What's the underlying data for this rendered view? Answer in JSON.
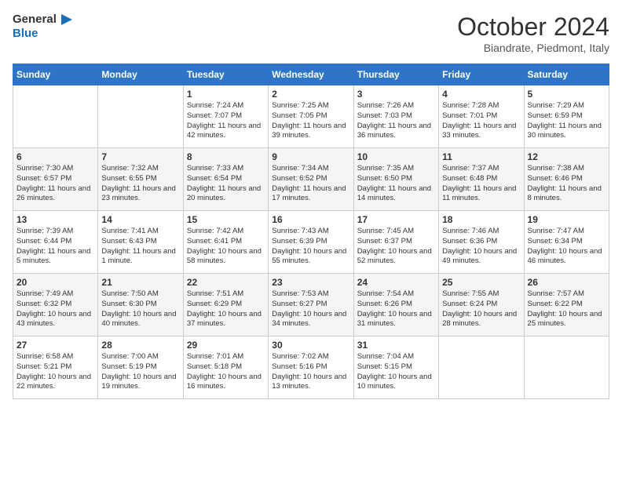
{
  "header": {
    "logo_line1": "General",
    "logo_line2": "Blue",
    "month": "October 2024",
    "location": "Biandrate, Piedmont, Italy"
  },
  "days_of_week": [
    "Sunday",
    "Monday",
    "Tuesday",
    "Wednesday",
    "Thursday",
    "Friday",
    "Saturday"
  ],
  "weeks": [
    [
      {
        "day": "",
        "info": ""
      },
      {
        "day": "",
        "info": ""
      },
      {
        "day": "1",
        "info": "Sunrise: 7:24 AM\nSunset: 7:07 PM\nDaylight: 11 hours and 42 minutes."
      },
      {
        "day": "2",
        "info": "Sunrise: 7:25 AM\nSunset: 7:05 PM\nDaylight: 11 hours and 39 minutes."
      },
      {
        "day": "3",
        "info": "Sunrise: 7:26 AM\nSunset: 7:03 PM\nDaylight: 11 hours and 36 minutes."
      },
      {
        "day": "4",
        "info": "Sunrise: 7:28 AM\nSunset: 7:01 PM\nDaylight: 11 hours and 33 minutes."
      },
      {
        "day": "5",
        "info": "Sunrise: 7:29 AM\nSunset: 6:59 PM\nDaylight: 11 hours and 30 minutes."
      }
    ],
    [
      {
        "day": "6",
        "info": "Sunrise: 7:30 AM\nSunset: 6:57 PM\nDaylight: 11 hours and 26 minutes."
      },
      {
        "day": "7",
        "info": "Sunrise: 7:32 AM\nSunset: 6:55 PM\nDaylight: 11 hours and 23 minutes."
      },
      {
        "day": "8",
        "info": "Sunrise: 7:33 AM\nSunset: 6:54 PM\nDaylight: 11 hours and 20 minutes."
      },
      {
        "day": "9",
        "info": "Sunrise: 7:34 AM\nSunset: 6:52 PM\nDaylight: 11 hours and 17 minutes."
      },
      {
        "day": "10",
        "info": "Sunrise: 7:35 AM\nSunset: 6:50 PM\nDaylight: 11 hours and 14 minutes."
      },
      {
        "day": "11",
        "info": "Sunrise: 7:37 AM\nSunset: 6:48 PM\nDaylight: 11 hours and 11 minutes."
      },
      {
        "day": "12",
        "info": "Sunrise: 7:38 AM\nSunset: 6:46 PM\nDaylight: 11 hours and 8 minutes."
      }
    ],
    [
      {
        "day": "13",
        "info": "Sunrise: 7:39 AM\nSunset: 6:44 PM\nDaylight: 11 hours and 5 minutes."
      },
      {
        "day": "14",
        "info": "Sunrise: 7:41 AM\nSunset: 6:43 PM\nDaylight: 11 hours and 1 minute."
      },
      {
        "day": "15",
        "info": "Sunrise: 7:42 AM\nSunset: 6:41 PM\nDaylight: 10 hours and 58 minutes."
      },
      {
        "day": "16",
        "info": "Sunrise: 7:43 AM\nSunset: 6:39 PM\nDaylight: 10 hours and 55 minutes."
      },
      {
        "day": "17",
        "info": "Sunrise: 7:45 AM\nSunset: 6:37 PM\nDaylight: 10 hours and 52 minutes."
      },
      {
        "day": "18",
        "info": "Sunrise: 7:46 AM\nSunset: 6:36 PM\nDaylight: 10 hours and 49 minutes."
      },
      {
        "day": "19",
        "info": "Sunrise: 7:47 AM\nSunset: 6:34 PM\nDaylight: 10 hours and 46 minutes."
      }
    ],
    [
      {
        "day": "20",
        "info": "Sunrise: 7:49 AM\nSunset: 6:32 PM\nDaylight: 10 hours and 43 minutes."
      },
      {
        "day": "21",
        "info": "Sunrise: 7:50 AM\nSunset: 6:30 PM\nDaylight: 10 hours and 40 minutes."
      },
      {
        "day": "22",
        "info": "Sunrise: 7:51 AM\nSunset: 6:29 PM\nDaylight: 10 hours and 37 minutes."
      },
      {
        "day": "23",
        "info": "Sunrise: 7:53 AM\nSunset: 6:27 PM\nDaylight: 10 hours and 34 minutes."
      },
      {
        "day": "24",
        "info": "Sunrise: 7:54 AM\nSunset: 6:26 PM\nDaylight: 10 hours and 31 minutes."
      },
      {
        "day": "25",
        "info": "Sunrise: 7:55 AM\nSunset: 6:24 PM\nDaylight: 10 hours and 28 minutes."
      },
      {
        "day": "26",
        "info": "Sunrise: 7:57 AM\nSunset: 6:22 PM\nDaylight: 10 hours and 25 minutes."
      }
    ],
    [
      {
        "day": "27",
        "info": "Sunrise: 6:58 AM\nSunset: 5:21 PM\nDaylight: 10 hours and 22 minutes."
      },
      {
        "day": "28",
        "info": "Sunrise: 7:00 AM\nSunset: 5:19 PM\nDaylight: 10 hours and 19 minutes."
      },
      {
        "day": "29",
        "info": "Sunrise: 7:01 AM\nSunset: 5:18 PM\nDaylight: 10 hours and 16 minutes."
      },
      {
        "day": "30",
        "info": "Sunrise: 7:02 AM\nSunset: 5:16 PM\nDaylight: 10 hours and 13 minutes."
      },
      {
        "day": "31",
        "info": "Sunrise: 7:04 AM\nSunset: 5:15 PM\nDaylight: 10 hours and 10 minutes."
      },
      {
        "day": "",
        "info": ""
      },
      {
        "day": "",
        "info": ""
      }
    ]
  ]
}
